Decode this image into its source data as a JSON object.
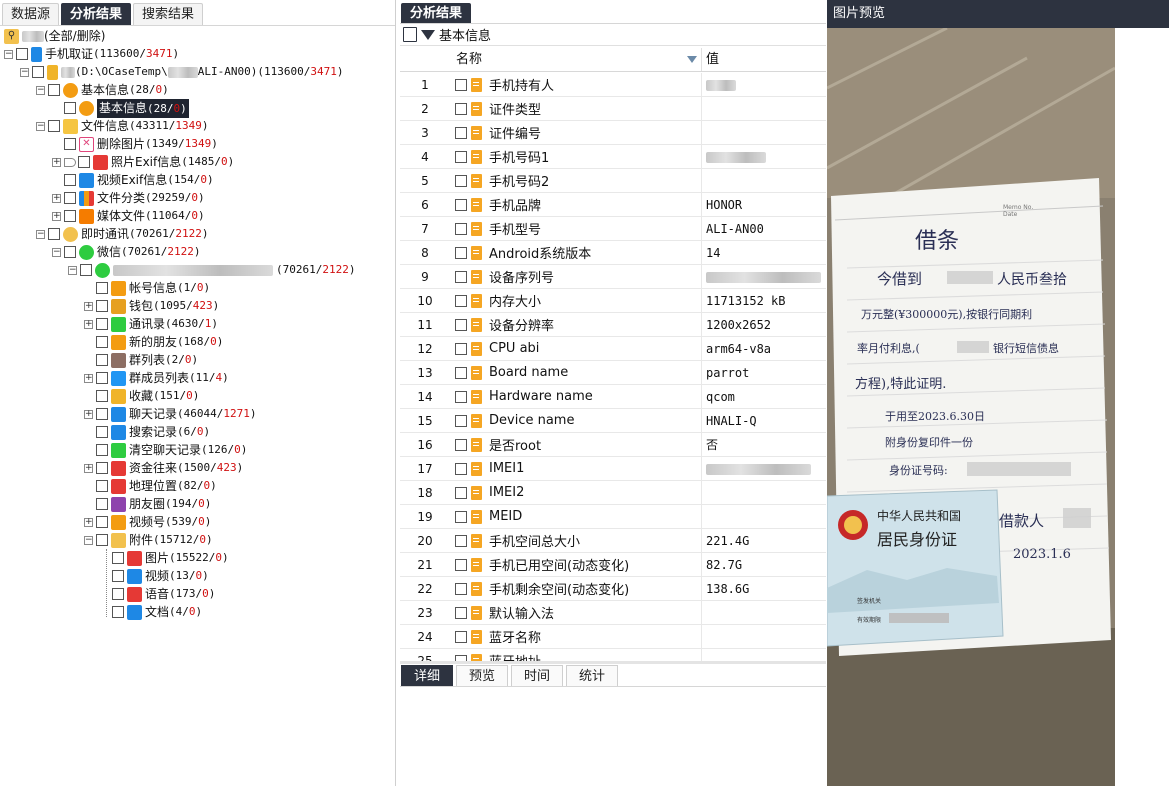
{
  "left_tabs": [
    "数据源",
    "分析结果",
    "搜索结果"
  ],
  "tree": {
    "root_label": "(全部/删除)",
    "phone": {
      "label": "手机取证",
      "total": "113600",
      "deleted": "3471"
    },
    "case": {
      "prefix": "(D:\\OCaseTemp\\",
      "suffix": "ALI-AN00)",
      "total": "113600",
      "deleted": "3471"
    },
    "basic": {
      "label": "基本信息",
      "total": "28",
      "deleted": "0"
    },
    "basic_child": {
      "label": "基本信息",
      "total": "28",
      "deleted": "0"
    },
    "files": {
      "label": "文件信息",
      "total": "43311",
      "deleted": "1349"
    },
    "deleted_pics": {
      "label": "删除图片",
      "total": "1349",
      "deleted": "1349"
    },
    "photo_exif": {
      "label": "照片Exif信息",
      "total": "1485",
      "deleted": "0"
    },
    "video_exif": {
      "label": "视频Exif信息",
      "total": "154",
      "deleted": "0"
    },
    "file_class": {
      "label": "文件分类",
      "total": "29259",
      "deleted": "0"
    },
    "media_files": {
      "label": "媒体文件",
      "total": "11064",
      "deleted": "0"
    },
    "im": {
      "label": "即时通讯",
      "total": "70261",
      "deleted": "2122"
    },
    "wechat": {
      "label": "微信",
      "total": "70261",
      "deleted": "2122"
    },
    "account": {
      "total": "70261",
      "deleted": "2122"
    },
    "wechat_items": [
      {
        "label": "帐号信息",
        "total": "1",
        "deleted": "0"
      },
      {
        "label": "钱包",
        "total": "1095",
        "deleted": "423"
      },
      {
        "label": "通讯录",
        "total": "4630",
        "deleted": "1"
      },
      {
        "label": "新的朋友",
        "total": "168",
        "deleted": "0"
      },
      {
        "label": "群列表",
        "total": "2",
        "deleted": "0"
      },
      {
        "label": "群成员列表",
        "total": "11",
        "deleted": "4"
      },
      {
        "label": "收藏",
        "total": "151",
        "deleted": "0"
      },
      {
        "label": "聊天记录",
        "total": "46044",
        "deleted": "1271"
      },
      {
        "label": "搜索记录",
        "total": "6",
        "deleted": "0"
      },
      {
        "label": "清空聊天记录",
        "total": "126",
        "deleted": "0"
      },
      {
        "label": "资金往来",
        "total": "1500",
        "deleted": "423"
      },
      {
        "label": "地理位置",
        "total": "82",
        "deleted": "0"
      },
      {
        "label": "朋友圈",
        "total": "194",
        "deleted": "0"
      },
      {
        "label": "视频号",
        "total": "539",
        "deleted": "0"
      },
      {
        "label": "附件",
        "total": "15712",
        "deleted": "0"
      }
    ],
    "attachment_items": [
      {
        "label": "图片",
        "total": "15522",
        "deleted": "0"
      },
      {
        "label": "视频",
        "total": "13",
        "deleted": "0"
      },
      {
        "label": "语音",
        "total": "173",
        "deleted": "0"
      },
      {
        "label": "文档",
        "total": "4",
        "deleted": "0"
      }
    ]
  },
  "middle": {
    "tab": "分析结果",
    "toolbar_label": "基本信息",
    "col_name": "名称",
    "col_value": "值",
    "rows": [
      {
        "n": "1",
        "name": "手机持有人",
        "value": ""
      },
      {
        "n": "2",
        "name": "证件类型",
        "value": ""
      },
      {
        "n": "3",
        "name": "证件编号",
        "value": ""
      },
      {
        "n": "4",
        "name": "手机号码1",
        "value": ""
      },
      {
        "n": "5",
        "name": "手机号码2",
        "value": ""
      },
      {
        "n": "6",
        "name": "手机品牌",
        "value": "HONOR"
      },
      {
        "n": "7",
        "name": "手机型号",
        "value": "ALI-AN00"
      },
      {
        "n": "8",
        "name": "Android系统版本",
        "value": "14"
      },
      {
        "n": "9",
        "name": "设备序列号",
        "value": ""
      },
      {
        "n": "10",
        "name": "内存大小",
        "value": "11713152 kB"
      },
      {
        "n": "11",
        "name": "设备分辨率",
        "value": "1200x2652"
      },
      {
        "n": "12",
        "name": "CPU abi",
        "value": "arm64-v8a"
      },
      {
        "n": "13",
        "name": "Board name",
        "value": "parrot"
      },
      {
        "n": "14",
        "name": "Hardware name",
        "value": "qcom"
      },
      {
        "n": "15",
        "name": "Device name",
        "value": "HNALI-Q"
      },
      {
        "n": "16",
        "name": "是否root",
        "value": "否"
      },
      {
        "n": "17",
        "name": "IMEI1",
        "value": ""
      },
      {
        "n": "18",
        "name": "IMEI2",
        "value": ""
      },
      {
        "n": "19",
        "name": "MEID",
        "value": ""
      },
      {
        "n": "20",
        "name": "手机空间总大小",
        "value": "221.4G"
      },
      {
        "n": "21",
        "name": "手机已用空间(动态变化)",
        "value": "82.7G"
      },
      {
        "n": "22",
        "name": "手机剩余空间(动态变化)",
        "value": "138.6G"
      },
      {
        "n": "23",
        "name": "默认输入法",
        "value": ""
      },
      {
        "n": "24",
        "name": "蓝牙名称",
        "value": ""
      },
      {
        "n": "25",
        "name": "蓝牙地址",
        "value": ""
      }
    ],
    "bottom_tabs": [
      "详细",
      "预览",
      "时间",
      "统计"
    ]
  },
  "right": {
    "title": "图片预览",
    "note": {
      "title": "借条",
      "line1": "今借到",
      "line1b": "人民币叁拾",
      "line2": "万元整(¥300000元),按银行同期利",
      "line3": "率月付利息,(",
      "line3b": "银行短信债息",
      "line4": "方程),特此证明.",
      "line5": "于用至2023.6.30日",
      "line6": "附身份复印件一份",
      "line7": "身份证号码:",
      "line8": "借款人",
      "line9": "2023.1.6",
      "memo_label": "Memo No.",
      "date_label": "Date"
    },
    "id_card": {
      "country": "中华人民共和国",
      "title": "居民身份证",
      "authority_label": "签发机关",
      "validity_label": "有效期限"
    }
  }
}
